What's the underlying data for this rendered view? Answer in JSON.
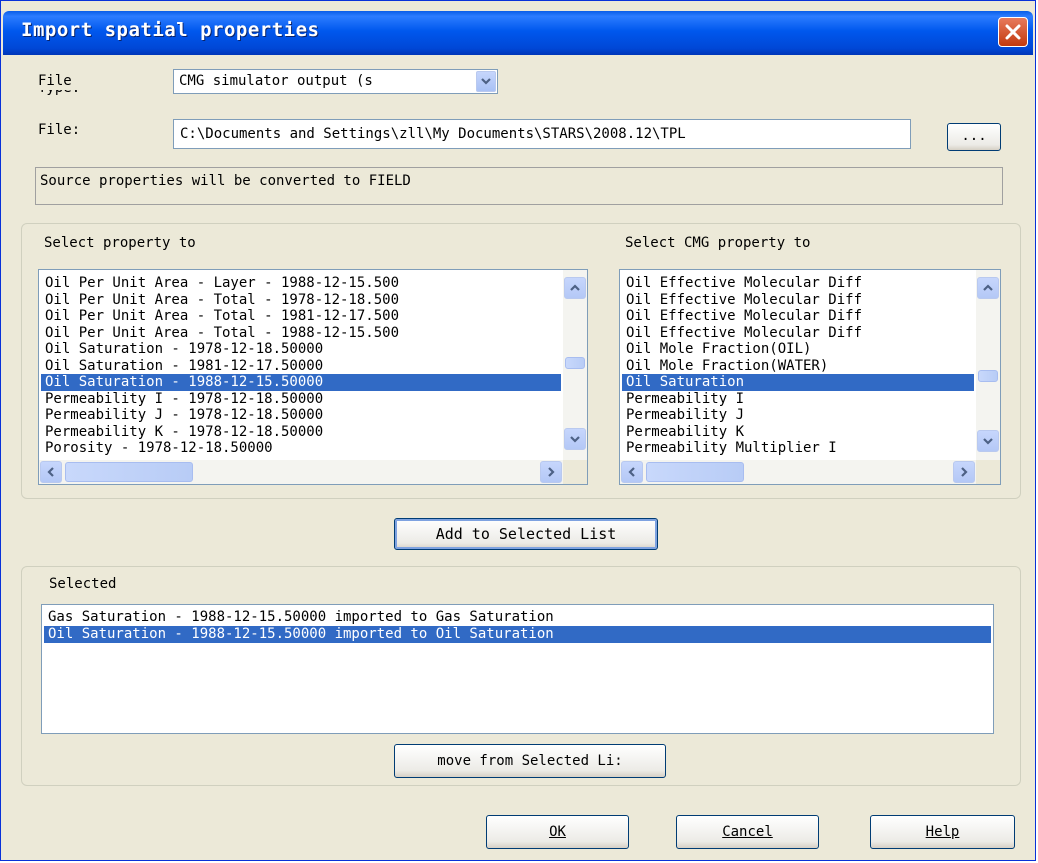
{
  "window": {
    "title": "Import spatial properties"
  },
  "file_type": {
    "label": "File",
    "selected": "CMG simulator output (s"
  },
  "file": {
    "label": "File:",
    "path": "C:\\Documents and Settings\\zll\\My Documents\\STARS\\2008.12\\TPL",
    "browse_label": "..."
  },
  "status_text": "Source properties will be converted to FIELD",
  "source_list": {
    "label": "Select property to",
    "items": [
      "Oil Per Unit Area - Layer - 1988-12-15.500",
      "Oil Per Unit Area - Total - 1978-12-18.500",
      "Oil Per Unit Area - Total - 1981-12-17.500",
      "Oil Per Unit Area - Total - 1988-12-15.500",
      "Oil Saturation - 1978-12-18.50000",
      "Oil Saturation - 1981-12-17.50000",
      "Oil Saturation - 1988-12-15.50000",
      "Permeability I - 1978-12-18.50000",
      "Permeability J - 1978-12-18.50000",
      "Permeability K - 1978-12-18.50000",
      "Porosity - 1978-12-18.50000"
    ],
    "selected_index": 6
  },
  "target_list": {
    "label": "Select CMG property to",
    "items": [
      "Oil Effective Molecular Diff",
      "Oil Effective Molecular Diff",
      "Oil Effective Molecular Diff",
      "Oil Effective Molecular Diff",
      "Oil Mole Fraction(OIL)",
      "Oil Mole Fraction(WATER)",
      "Oil Saturation",
      "Permeability I",
      "Permeability J",
      "Permeability K",
      "Permeability Multiplier I"
    ],
    "selected_index": 6
  },
  "add_button": "Add to Selected List",
  "selected": {
    "label": "Selected",
    "items": [
      "Gas Saturation - 1988-12-15.50000 imported to Gas Saturation",
      "Oil Saturation - 1988-12-15.50000 imported to Oil Saturation"
    ],
    "selected_index": 1
  },
  "remove_button": "move from Selected Li:",
  "buttons": {
    "ok": "OK",
    "cancel": "Cancel",
    "help": "Help"
  },
  "colors": {
    "title_bar": "#0058ee",
    "selection": "#316ac5",
    "dialog_bg": "#ece9d8"
  }
}
